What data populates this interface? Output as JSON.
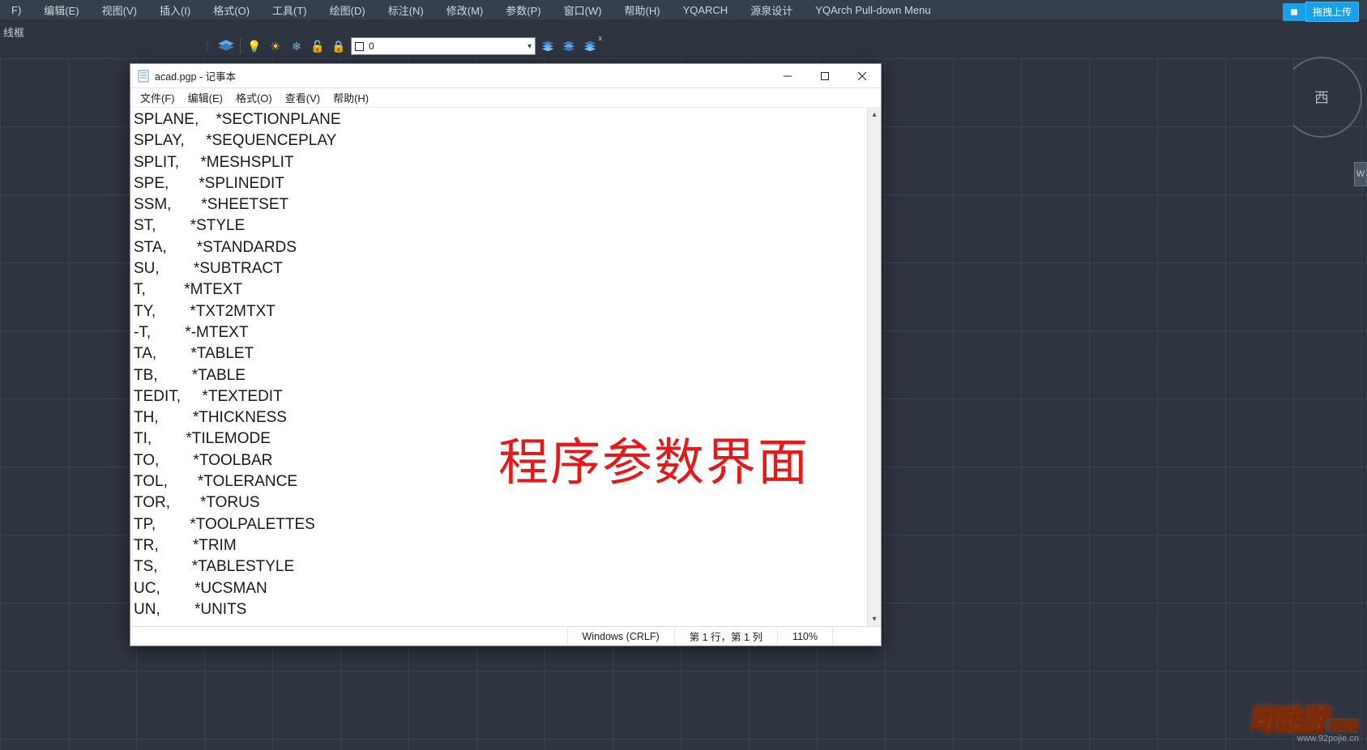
{
  "cad_menu": [
    "F)",
    "编辑(E)",
    "视图(V)",
    "插入(I)",
    "格式(O)",
    "工具(T)",
    "绘图(D)",
    "标注(N)",
    "修改(M)",
    "参数(P)",
    "窗口(W)",
    "帮助(H)",
    "YQARCH",
    "源泉设计",
    "YQArch Pull-down Menu"
  ],
  "upload": {
    "drag_label": "拖拽上传"
  },
  "wireframe_label": "线框",
  "layer_dropdown": {
    "value": "0"
  },
  "viewcube_face": "西",
  "viewcube_handle": "W",
  "notepad": {
    "title": "acad.pgp - 记事本",
    "menu": [
      "文件(F)",
      "编辑(E)",
      "格式(O)",
      "查看(V)",
      "帮助(H)"
    ],
    "lines": [
      "SPLANE,    *SECTIONPLANE",
      "SPLAY,     *SEQUENCEPLAY",
      "SPLIT,     *MESHSPLIT",
      "SPE,       *SPLINEDIT",
      "SSM,       *SHEETSET",
      "ST,        *STYLE",
      "STA,       *STANDARDS",
      "SU,        *SUBTRACT",
      "T,         *MTEXT",
      "TY,        *TXT2MTXT",
      "-T,        *-MTEXT",
      "TA,        *TABLET",
      "TB,        *TABLE",
      "TEDIT,     *TEXTEDIT",
      "TH,        *THICKNESS",
      "TI,        *TILEMODE",
      "TO,        *TOOLBAR",
      "TOL,       *TOLERANCE",
      "TOR,       *TORUS",
      "TP,        *TOOLPALETTES",
      "TR,        *TRIM",
      "TS,        *TABLESTYLE",
      "UC,        *UCSMAN",
      "UN,        *UNITS"
    ],
    "status": {
      "encoding": "Windows (CRLF)",
      "position": "第 1 行，第 1 列",
      "zoom": "110%"
    }
  },
  "red_caption": "程序参数界面",
  "game_logo": {
    "main": "司徒游",
    "sub": "www.92pojie.cn",
    "tail": "评论坛"
  }
}
